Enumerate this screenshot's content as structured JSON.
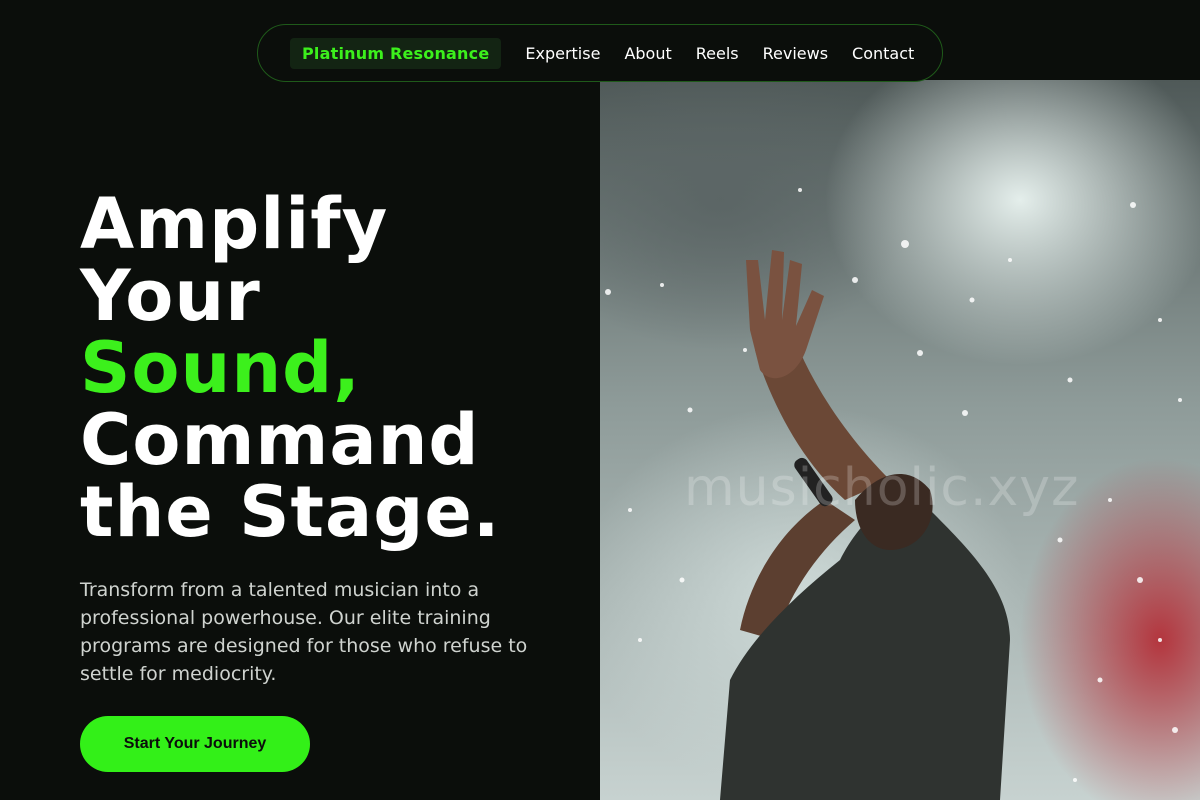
{
  "nav": {
    "brand": "Platinum Resonance",
    "links": [
      "Expertise",
      "About",
      "Reels",
      "Reviews",
      "Contact"
    ]
  },
  "hero": {
    "headline": {
      "line1": "Amplify",
      "line2": "Your",
      "line3_accent": "Sound,",
      "line4": "Command",
      "line5": "the Stage."
    },
    "description": "Transform from a talented musician into a professional powerhouse. Our elite training programs are designed for those who refuse to settle for mediocrity.",
    "cta_label": "Start Your Journey",
    "image_watermark": "musicholic.xyz"
  },
  "colors": {
    "background": "#0b0e0b",
    "accent": "#3cf01c",
    "text": "#ffffff",
    "muted_text": "#cfd3cf"
  },
  "icons": {
    "hero_image": "performer-with-microphone-photo"
  }
}
